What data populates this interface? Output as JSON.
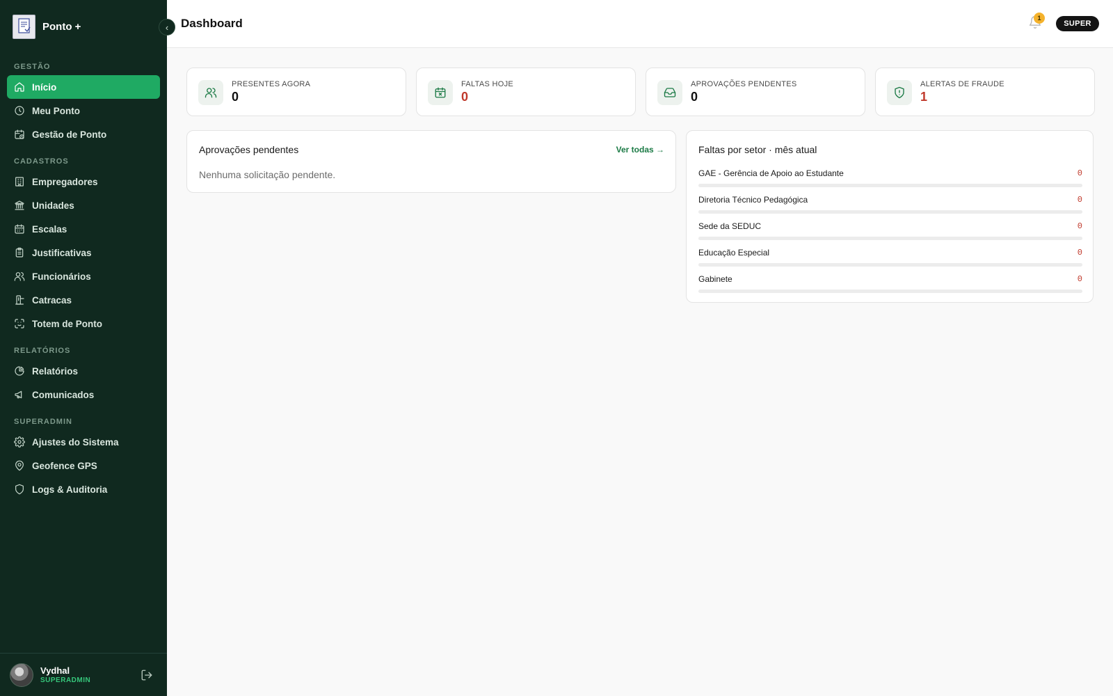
{
  "brand": {
    "name": "Ponto +",
    "logo_icon": "document-logo-icon"
  },
  "sidebar": {
    "sections": [
      {
        "title": "GESTÃO",
        "items": [
          {
            "label": "Início",
            "icon": "home-icon",
            "active": true
          },
          {
            "label": "Meu Ponto",
            "icon": "clock-icon"
          },
          {
            "label": "Gestão de Ponto",
            "icon": "calendar-clock-icon"
          }
        ]
      },
      {
        "title": "CADASTROS",
        "items": [
          {
            "label": "Empregadores",
            "icon": "building-icon"
          },
          {
            "label": "Unidades",
            "icon": "landmark-icon"
          },
          {
            "label": "Escalas",
            "icon": "calendar-icon"
          },
          {
            "label": "Justificativas",
            "icon": "clipboard-icon"
          },
          {
            "label": "Funcionários",
            "icon": "users-icon"
          },
          {
            "label": "Catracas",
            "icon": "turnstile-icon"
          },
          {
            "label": "Totem de Ponto",
            "icon": "scan-face-icon"
          }
        ]
      },
      {
        "title": "RELATÓRIOS",
        "items": [
          {
            "label": "Relatórios",
            "icon": "pie-chart-icon"
          },
          {
            "label": "Comunicados",
            "icon": "megaphone-icon"
          }
        ]
      },
      {
        "title": "SUPERADMIN",
        "items": [
          {
            "label": "Ajustes do Sistema",
            "icon": "gear-icon"
          },
          {
            "label": "Geofence GPS",
            "icon": "map-pin-icon"
          },
          {
            "label": "Logs & Auditoria",
            "icon": "shield-icon"
          }
        ]
      }
    ]
  },
  "user": {
    "name": "Vydhal",
    "role": "SUPERADMIN"
  },
  "header": {
    "title": "Dashboard",
    "notifications": "1",
    "role_badge": "SUPER"
  },
  "stats": [
    {
      "label": "PRESENTES AGORA",
      "value": "0",
      "icon": "users-icon",
      "alert": false
    },
    {
      "label": "FALTAS HOJE",
      "value": "0",
      "icon": "calendar-x-icon",
      "alert": true
    },
    {
      "label": "APROVAÇÕES PENDENTES",
      "value": "0",
      "icon": "inbox-icon",
      "alert": false
    },
    {
      "label": "ALERTAS DE FRAUDE",
      "value": "1",
      "icon": "shield-alert-icon",
      "alert": true
    }
  ],
  "approvals": {
    "title": "Aprovações pendentes",
    "link": "Ver todas →",
    "empty": "Nenhuma solicitação pendente."
  },
  "absences": {
    "title": "Faltas por setor · mês atual",
    "sectors": [
      {
        "name": "GAE - Gerência de Apoio ao Estudante",
        "count": "0",
        "fraction": 0
      },
      {
        "name": "Diretoria Técnico Pedagógica",
        "count": "0",
        "fraction": 0
      },
      {
        "name": "Sede da SEDUC",
        "count": "0",
        "fraction": 0
      },
      {
        "name": "Educação Especial",
        "count": "0",
        "fraction": 0
      },
      {
        "name": "Gabinete",
        "count": "0",
        "fraction": 0
      }
    ]
  },
  "colors": {
    "sidebar": "#10291f",
    "accent": "#1faa63",
    "alert": "#c0392b",
    "badge": "#f4b22c"
  }
}
